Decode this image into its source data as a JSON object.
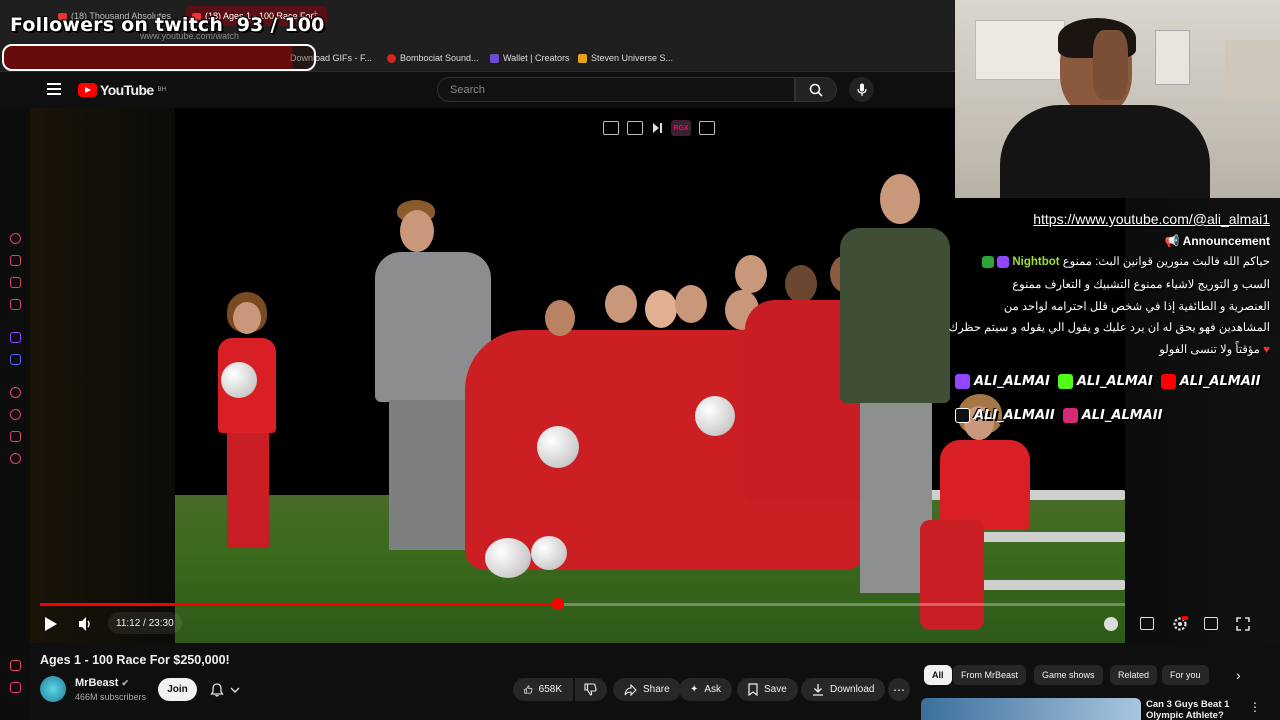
{
  "browser": {
    "tabs": [
      {
        "label": "(18) Thousand Absolutes"
      },
      {
        "label": "(18) Ages 1 - 100 Race For...",
        "active": true
      }
    ],
    "new_tab_icon": "plus-icon",
    "url": "www.youtube.com/watch",
    "bookmarks": [
      {
        "label": "Download GIFs - F...",
        "color": "#444444"
      },
      {
        "label": "Bombociat Sound...",
        "color": "#d9231d"
      },
      {
        "label": "Wallet | Creators",
        "color": "#6b4bd8"
      },
      {
        "label": "Steven Universe S...",
        "color": "#e8a317"
      }
    ]
  },
  "overlay": {
    "followers_label": "Followers on twitch",
    "followers_count": "93 / 100",
    "followers_progress": 0.93
  },
  "youtube": {
    "logo_text": "YouTube",
    "region": "BH",
    "search_placeholder": "Search",
    "player": {
      "current_time": "11:12",
      "duration": "23:30",
      "time_display": "11:12 / 23:30",
      "progress": 0.477,
      "accent": "#ff0000",
      "overlay_badge": "RGX"
    },
    "video": {
      "title": "Ages 1 - 100 Race For $250,000!",
      "channel": "MrBeast",
      "subscribers": "466M subscribers",
      "join_label": "Join",
      "likes": "658K",
      "share_label": "Share",
      "ask_label": "Ask",
      "save_label": "Save",
      "download_label": "Download"
    },
    "chips": [
      "All",
      "From MrBeast",
      "Game shows",
      "Related",
      "For you"
    ],
    "recommendation": {
      "title": "Can 3 Guys Beat 1 Olympic Athlete?"
    }
  },
  "chat": {
    "link": "https://www.youtube.com/@ali_almai1",
    "announcement": "Announcement",
    "bot_name": "Nightbot",
    "rules_lines": [
      "حياكم الله فالبث منورين قوانين البث: ممنوع",
      "السب و التوريج لاشياء  ممنوع التشبيك و التعارف ممنوع",
      "العنصرية و الطائفية إذا في شخص قلل احترامه لواحد من",
      "المشاهدين فهو يحق له ان يرد عليك و يقول الي يقوله و سيتم حظرك",
      "مؤقتاً ولا تنسى الفولو"
    ],
    "socials": [
      {
        "platform": "twitch",
        "handle": "ALI_ALMAI",
        "color": "#9146ff"
      },
      {
        "platform": "kick",
        "handle": "ALI_ALMAI",
        "color": "#53fc18"
      },
      {
        "platform": "youtube",
        "handle": "ALI_ALMAII",
        "color": "#ff0000"
      },
      {
        "platform": "tiktok",
        "handle": "ALI_ALMAII",
        "color": "#111111"
      },
      {
        "platform": "instagram",
        "handle": "ALI_ALMAII",
        "color": "#d62976"
      }
    ]
  }
}
